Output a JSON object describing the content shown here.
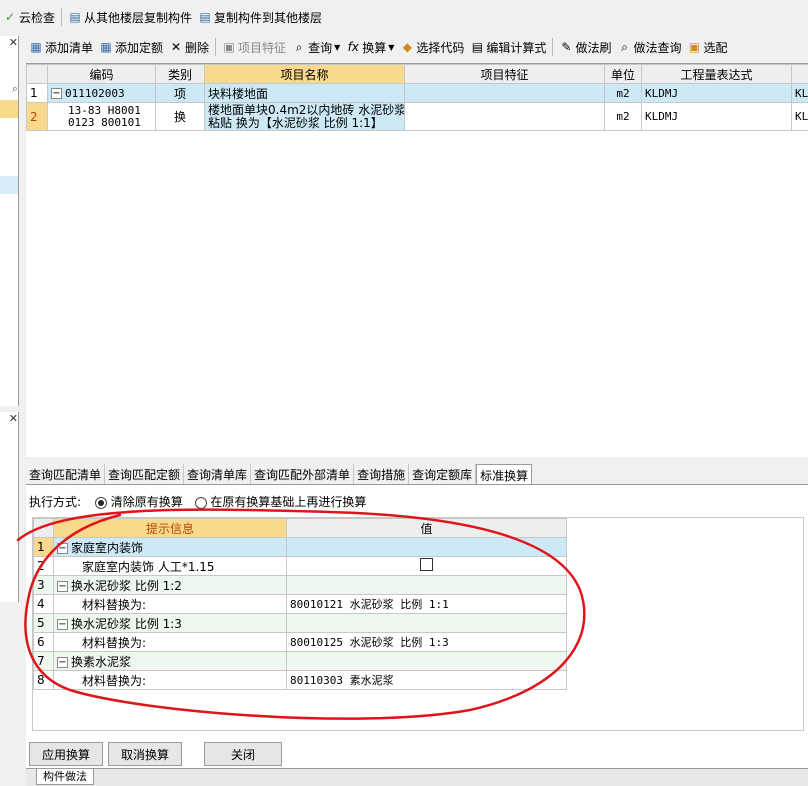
{
  "top_toolbar": {
    "items": [
      "云检查",
      "从其他楼层复制构件",
      "复制构件到其他楼层"
    ]
  },
  "main_toolbar": {
    "items": [
      "添加清单",
      "添加定额",
      "删除",
      "项目特征",
      "查询",
      "换算",
      "选择代码",
      "编辑计算式",
      "做法刷",
      "做法查询",
      "选配"
    ]
  },
  "top_table": {
    "columns": [
      "编码",
      "类别",
      "项目名称",
      "项目特征",
      "单位",
      "工程量表达式"
    ],
    "rows": [
      {
        "num": "1",
        "code": "011102003",
        "type": "项",
        "name": "块料楼地面",
        "feature": "",
        "unit": "m2",
        "expr": "KLDMJ",
        "extra": "KLD"
      },
      {
        "num": "2",
        "code_line1": "13-83 H8001",
        "code_line2": "0123 800101",
        "type": "换",
        "name_line1": "楼地面单块0.4m2以内地砖 水泥砂浆",
        "name_line2": "粘贴 换为【水泥砂浆 比例 1:1】",
        "feature": "",
        "unit": "m2",
        "expr": "KLDMJ",
        "extra": "KLD"
      }
    ]
  },
  "bottom_tabs": [
    "查询匹配清单",
    "查询匹配定额",
    "查询清单库",
    "查询匹配外部清单",
    "查询措施",
    "查询定额库",
    "标准换算"
  ],
  "exec_mode": {
    "label": "执行方式:",
    "option1": "清除原有换算",
    "option2": "在原有换算基础上再进行换算"
  },
  "hint_table": {
    "columns": [
      "提示信息",
      "值"
    ],
    "rows": [
      {
        "num": "1",
        "text": "家庭室内装饰",
        "value": ""
      },
      {
        "num": "2",
        "text": "家庭室内装饰 人工*1.15",
        "value": ""
      },
      {
        "num": "3",
        "text": "换水泥砂浆 比例 1:2",
        "value": ""
      },
      {
        "num": "4",
        "text": "材料替换为:",
        "value": "80010121  水泥砂浆 比例 1:1"
      },
      {
        "num": "5",
        "text": "换水泥砂浆 比例 1:3",
        "value": ""
      },
      {
        "num": "6",
        "text": "材料替换为:",
        "value": "80010125  水泥砂浆 比例 1:3"
      },
      {
        "num": "7",
        "text": "换素水泥浆",
        "value": ""
      },
      {
        "num": "8",
        "text": "材料替换为:",
        "value": "80110303  素水泥浆"
      }
    ]
  },
  "buttons": {
    "apply": "应用换算",
    "cancel": "取消换算",
    "close": "关闭"
  },
  "bottom_tab": "构件做法",
  "colors": {
    "header_highlight": "#f9d98c",
    "row_highlight": "#cde9f6",
    "annotation": "#e0141b"
  }
}
